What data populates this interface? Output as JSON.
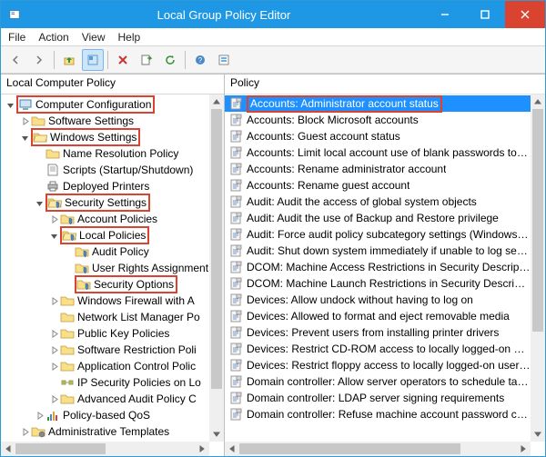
{
  "title": "Local Group Policy Editor",
  "menubar": [
    "File",
    "Action",
    "View",
    "Help"
  ],
  "left_header": "Local Computer Policy",
  "right_header": "Policy",
  "tree": {
    "root": {
      "label": "Computer Configuration",
      "hl": true
    },
    "n_soft": {
      "label": "Software Settings"
    },
    "n_win": {
      "label": "Windows Settings",
      "hl": true
    },
    "n_nrp": {
      "label": "Name Resolution Policy"
    },
    "n_scr": {
      "label": "Scripts (Startup/Shutdown)"
    },
    "n_dep": {
      "label": "Deployed Printers"
    },
    "n_sec": {
      "label": "Security Settings",
      "hl": true
    },
    "n_acct": {
      "label": "Account Policies"
    },
    "n_loc": {
      "label": "Local Policies",
      "hl": true
    },
    "n_audit": {
      "label": "Audit Policy"
    },
    "n_ura": {
      "label": "User Rights Assignment"
    },
    "n_secopt": {
      "label": "Security Options",
      "hl": true
    },
    "n_wfw": {
      "label": "Windows Firewall with A"
    },
    "n_nlm": {
      "label": "Network List Manager Po"
    },
    "n_pkp": {
      "label": "Public Key Policies"
    },
    "n_srp": {
      "label": "Software Restriction Poli"
    },
    "n_acp": {
      "label": "Application Control Polic"
    },
    "n_ips": {
      "label": "IP Security Policies on Lo"
    },
    "n_aap": {
      "label": "Advanced Audit Policy C"
    },
    "n_pbq": {
      "label": "Policy-based QoS"
    },
    "n_adm": {
      "label": "Administrative Templates"
    }
  },
  "policies": [
    {
      "label": "Accounts: Administrator account status",
      "selected": true,
      "hl": true
    },
    {
      "label": "Accounts: Block Microsoft accounts"
    },
    {
      "label": "Accounts: Guest account status"
    },
    {
      "label": "Accounts: Limit local account use of blank passwords to co..."
    },
    {
      "label": "Accounts: Rename administrator account"
    },
    {
      "label": "Accounts: Rename guest account"
    },
    {
      "label": "Audit: Audit the access of global system objects"
    },
    {
      "label": "Audit: Audit the use of Backup and Restore privilege"
    },
    {
      "label": "Audit: Force audit policy subcategory settings (Windows Vis..."
    },
    {
      "label": "Audit: Shut down system immediately if unable to log secur..."
    },
    {
      "label": "DCOM: Machine Access Restrictions in Security Descriptor D..."
    },
    {
      "label": "DCOM: Machine Launch Restrictions in Security Descriptor D..."
    },
    {
      "label": "Devices: Allow undock without having to log on"
    },
    {
      "label": "Devices: Allowed to format and eject removable media"
    },
    {
      "label": "Devices: Prevent users from installing printer drivers"
    },
    {
      "label": "Devices: Restrict CD-ROM access to locally logged-on user ..."
    },
    {
      "label": "Devices: Restrict floppy access to locally logged-on user only"
    },
    {
      "label": "Domain controller: Allow server operators to schedule tasks"
    },
    {
      "label": "Domain controller: LDAP server signing requirements"
    },
    {
      "label": "Domain controller: Refuse machine account password chan..."
    }
  ]
}
